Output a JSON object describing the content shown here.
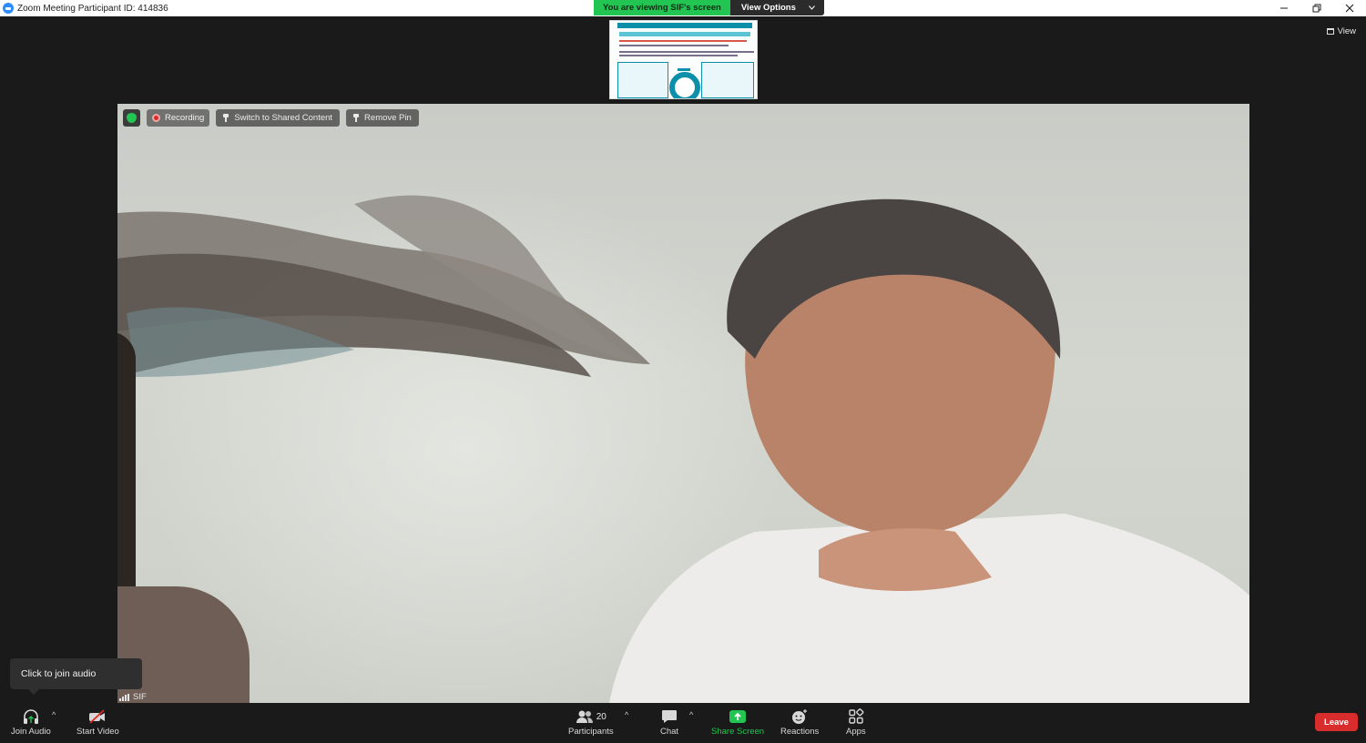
{
  "window": {
    "title": "Zoom Meeting Participant ID: 414836",
    "controls": [
      "minimize",
      "restore",
      "close"
    ]
  },
  "share_banner": {
    "status": "You are viewing SIF's screen",
    "view_options": "View Options"
  },
  "top_right": {
    "view_label": "View"
  },
  "video": {
    "recording_label": "Recording",
    "switch_label": "Switch to Shared Content",
    "remove_pin_label": "Remove Pin",
    "participant_name": "SIF"
  },
  "tooltip": {
    "text": "Click to join audio"
  },
  "toolbar": {
    "join_audio": "Join Audio",
    "start_video": "Start Video",
    "participants": "Participants",
    "participant_count": "20",
    "chat": "Chat",
    "share_screen": "Share Screen",
    "reactions": "Reactions",
    "apps": "Apps",
    "leave": "Leave"
  },
  "colors": {
    "share_green": "#23c552",
    "leave_red": "#d92c2c",
    "zoom_blue": "#2d8cff",
    "background": "#1a1a1a"
  }
}
